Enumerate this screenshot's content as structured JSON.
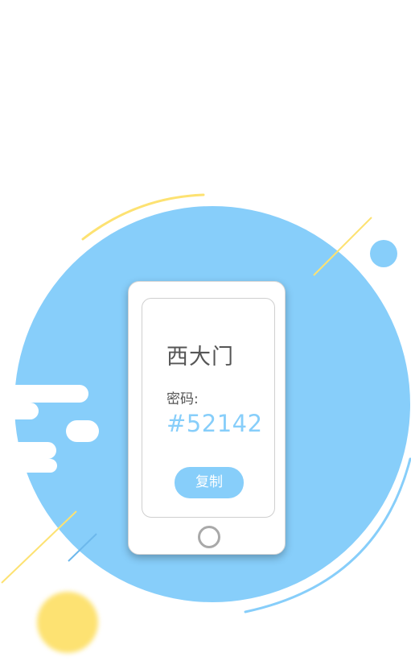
{
  "card": {
    "location": "西大门",
    "password_label": "密码:",
    "password_value": "#52142",
    "copy_label": "复制"
  },
  "icons": {
    "home": "home-button-icon",
    "phone": "phone-icon"
  },
  "colors": {
    "primary_blue": "#87cefa",
    "accent_yellow": "#fde272",
    "text_dark": "#555555",
    "background": "#ffffff"
  }
}
